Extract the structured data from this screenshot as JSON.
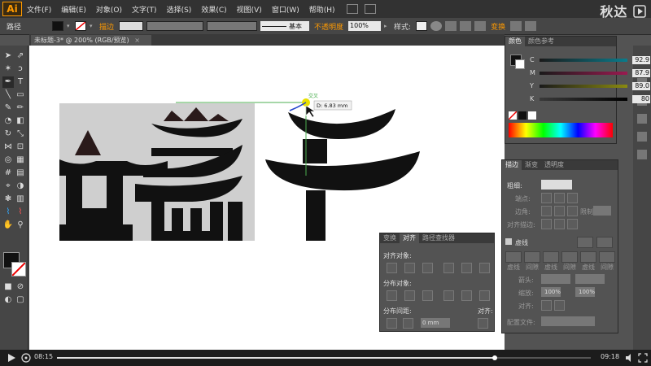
{
  "menubar": {
    "logo": "Ai",
    "items": [
      "文件(F)",
      "编辑(E)",
      "对象(O)",
      "文字(T)",
      "选择(S)",
      "效果(C)",
      "视图(V)",
      "窗口(W)",
      "帮助(H)"
    ],
    "brand": "秋达"
  },
  "control_bar": {
    "selection_label": "路径",
    "stroke_label": "描边",
    "stroke_style": "基本",
    "opacity_label": "不透明度",
    "opacity_value": "100%",
    "style_label": "样式:",
    "transform_label": "变换"
  },
  "document": {
    "tab_title": "未标题-3* @ 200% (RGB/预览)"
  },
  "canvas": {
    "tooltip_label": "交叉",
    "tooltip_text": "D: 6.83 mm"
  },
  "color_panel": {
    "tabs": [
      "颜色",
      "颜色参考"
    ],
    "sliders": [
      {
        "letter": "C",
        "value": "92.9",
        "color": "#1e5a6a"
      },
      {
        "letter": "M",
        "value": "87.9",
        "color": "#7a1d4a"
      },
      {
        "letter": "Y",
        "value": "89.0",
        "color": "#6a6a1a"
      },
      {
        "letter": "K",
        "value": "80",
        "color": "#111111"
      }
    ],
    "pct": "%"
  },
  "stroke_panel": {
    "tabs": [
      "描边",
      "渐变",
      "透明度"
    ],
    "weight_label": "粗细:",
    "cap_label": "端点:",
    "corner_label": "边角:",
    "limit_label": "限制:",
    "align_label": "对齐描边:",
    "dash_label": "虚线",
    "dash_fields": [
      "虚线",
      "间隙",
      "虚线",
      "间隙",
      "虚线",
      "间隙"
    ],
    "arrow_label": "箭头:",
    "scale_label": "缩放:",
    "scale_values": [
      "100%",
      "100%"
    ],
    "align2_label": "对齐:",
    "profile_label": "配置文件:"
  },
  "align_panel": {
    "tabs": [
      "变换",
      "对齐",
      "路径查找器"
    ],
    "align_objects": "对齐对象:",
    "distribute_objects": "分布对象:",
    "distribute_spacing": "分布间距:",
    "align_to": "对齐:",
    "spacing_value": "0 mm"
  },
  "timeline": {
    "current": "08:15",
    "total": "09:18",
    "progress": 0.82
  },
  "colors": {
    "accent": "#ff9a00",
    "panel": "#535353",
    "menubar": "#323232"
  }
}
